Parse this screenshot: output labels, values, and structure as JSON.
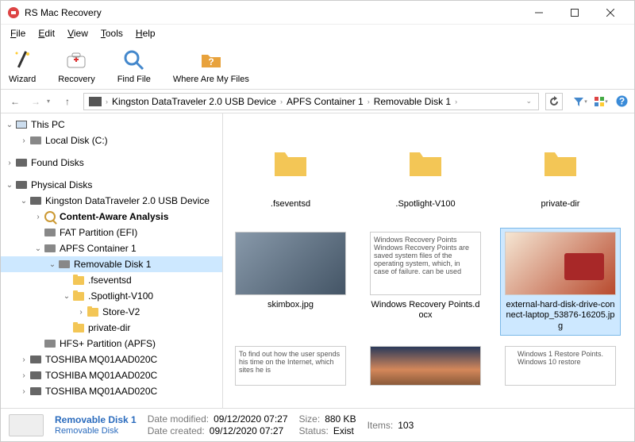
{
  "window": {
    "title": "RS Mac Recovery"
  },
  "menu": {
    "file": "File",
    "edit": "Edit",
    "view": "View",
    "tools": "Tools",
    "help": "Help"
  },
  "toolbar": {
    "wizard": "Wizard",
    "recovery": "Recovery",
    "find_file": "Find File",
    "where_files": "Where Are My Files"
  },
  "breadcrumb": {
    "seg1": "Kingston DataTraveler 2.0 USB Device",
    "seg2": "APFS Container 1",
    "seg3": "Removable Disk 1"
  },
  "tree": {
    "this_pc": "This PC",
    "local_disk": "Local Disk (C:)",
    "found_disks": "Found Disks",
    "physical_disks": "Physical Disks",
    "kingston": "Kingston DataTraveler 2.0 USB Device",
    "content_aware": "Content-Aware Analysis",
    "fat_partition": "FAT Partition (EFI)",
    "apfs_container": "APFS Container 1",
    "removable_disk": "Removable Disk 1",
    "fseventsd": ".fseventsd",
    "spotlight": ".Spotlight-V100",
    "store_v2": "Store-V2",
    "private_dir": "private-dir",
    "hfs_partition": "HFS+ Partition (APFS)",
    "toshiba": "TOSHIBA MQ01AAD020C"
  },
  "files": {
    "f1": ".fseventsd",
    "f2": ".Spotlight-V100",
    "f3": "private-dir",
    "f4": "skimbox.jpg",
    "f5_preview": "Windows Recovery Points\nWindows Recovery Points are saved system files of the operating system, which, in case of failure. can be used",
    "f5": "Windows Recovery Points.docx",
    "f6": "external-hard-disk-drive-connect-laptop_53876-16205.jpg",
    "f7_preview": "To find out how the user spends his time on the Internet, which sites he is",
    "f8_preview": "Windows 1 Restore Points.\nWindows 10 restore"
  },
  "status": {
    "name": "Removable Disk 1",
    "type": "Removable Disk",
    "mod_label": "Date modified:",
    "mod_value": "09/12/2020 07:27",
    "created_label": "Date created:",
    "created_value": "09/12/2020 07:27",
    "size_label": "Size:",
    "size_value": "880 KB",
    "status_label": "Status:",
    "status_value": "Exist",
    "items_label": "Items:",
    "items_value": "103"
  }
}
